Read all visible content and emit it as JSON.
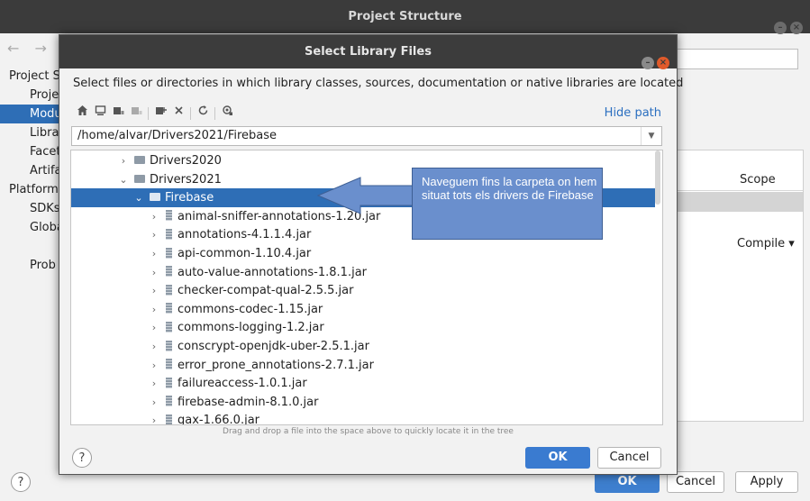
{
  "background_window": {
    "title": "Project Structure",
    "nav_arrows": "← →",
    "sidebar": [
      {
        "label": "Project S",
        "level": 0,
        "selected": false
      },
      {
        "label": "Proje",
        "level": 1,
        "selected": false
      },
      {
        "label": "Modu",
        "level": 1,
        "selected": true
      },
      {
        "label": "Libra",
        "level": 1,
        "selected": false
      },
      {
        "label": "Facet",
        "level": 1,
        "selected": false
      },
      {
        "label": "Artifa",
        "level": 1,
        "selected": false
      },
      {
        "label": "Platform",
        "level": 0,
        "selected": false
      },
      {
        "label": "SDKs",
        "level": 1,
        "selected": false
      },
      {
        "label": "Globa",
        "level": 1,
        "selected": false
      },
      {
        "label": "Prob",
        "level": 1,
        "selected": false
      }
    ],
    "table_header_scope": "Scope",
    "scope_value": "Compile ▾",
    "help_label": "?",
    "ok_label": "OK",
    "cancel_label": "Cancel",
    "apply_label": "Apply"
  },
  "dialog": {
    "title": "Select Library Files",
    "description": "Select files or directories in which library classes, sources, documentation or native libraries are located",
    "hide_path_label": "Hide path",
    "path": "/home/alvar/Drivers2021/Firebase",
    "drag_hint": "Drag and drop a file into the space above to quickly locate it in the tree",
    "help_label": "?",
    "ok_label": "OK",
    "cancel_label": "Cancel",
    "tree": [
      {
        "label": "Drivers2020",
        "kind": "folder",
        "depth": 0,
        "expanded": false,
        "selected": false
      },
      {
        "label": "Drivers2021",
        "kind": "folder",
        "depth": 0,
        "expanded": true,
        "selected": false
      },
      {
        "label": "Firebase",
        "kind": "folder",
        "depth": 1,
        "expanded": true,
        "selected": true
      },
      {
        "label": "animal-sniffer-annotations-1.20.jar",
        "kind": "jar",
        "depth": 2,
        "expanded": false,
        "selected": false
      },
      {
        "label": "annotations-4.1.1.4.jar",
        "kind": "jar",
        "depth": 2,
        "expanded": false,
        "selected": false
      },
      {
        "label": "api-common-1.10.4.jar",
        "kind": "jar",
        "depth": 2,
        "expanded": false,
        "selected": false
      },
      {
        "label": "auto-value-annotations-1.8.1.jar",
        "kind": "jar",
        "depth": 2,
        "expanded": false,
        "selected": false
      },
      {
        "label": "checker-compat-qual-2.5.5.jar",
        "kind": "jar",
        "depth": 2,
        "expanded": false,
        "selected": false
      },
      {
        "label": "commons-codec-1.15.jar",
        "kind": "jar",
        "depth": 2,
        "expanded": false,
        "selected": false
      },
      {
        "label": "commons-logging-1.2.jar",
        "kind": "jar",
        "depth": 2,
        "expanded": false,
        "selected": false
      },
      {
        "label": "conscrypt-openjdk-uber-2.5.1.jar",
        "kind": "jar",
        "depth": 2,
        "expanded": false,
        "selected": false
      },
      {
        "label": "error_prone_annotations-2.7.1.jar",
        "kind": "jar",
        "depth": 2,
        "expanded": false,
        "selected": false
      },
      {
        "label": "failureaccess-1.0.1.jar",
        "kind": "jar",
        "depth": 2,
        "expanded": false,
        "selected": false
      },
      {
        "label": "firebase-admin-8.1.0.jar",
        "kind": "jar",
        "depth": 2,
        "expanded": false,
        "selected": false
      },
      {
        "label": "gax-1.66.0.jar",
        "kind": "jar",
        "depth": 2,
        "expanded": false,
        "selected": false
      }
    ]
  },
  "annotation": {
    "text": "Naveguem fins la carpeta on hem situat tots els drivers de Firebase",
    "fill_color": "#6a8fcd"
  },
  "colors": {
    "selection": "#2e6eb6",
    "link": "#2b6fc0",
    "primary_button": "#3a7bd0"
  },
  "icons": [
    "home-icon",
    "desktop-icon",
    "project-icon",
    "module-icon",
    "new-folder-icon",
    "delete-icon",
    "refresh-icon",
    "show-hidden-icon"
  ]
}
